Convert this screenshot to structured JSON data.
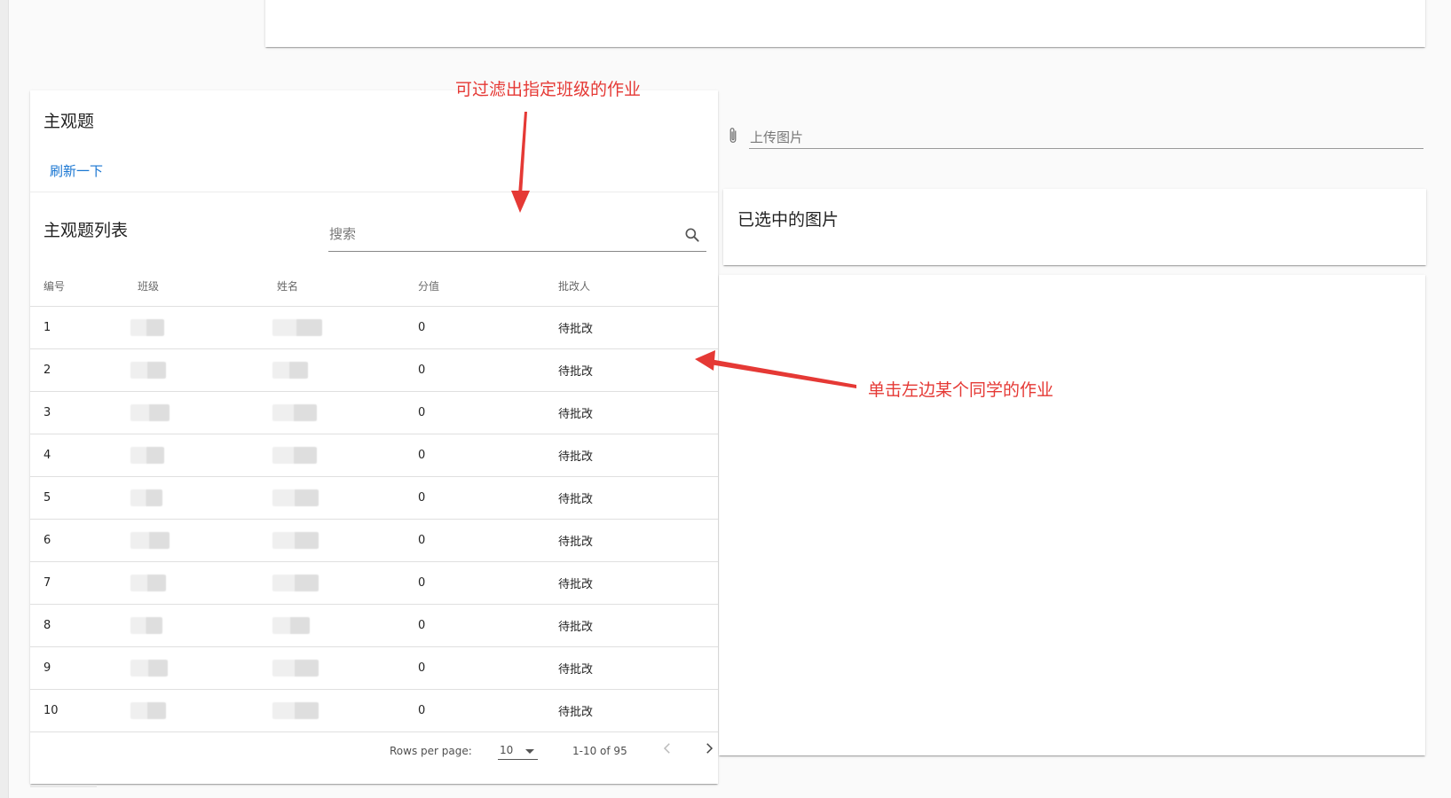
{
  "header": {
    "title": "主观题",
    "refresh_label": "刷新一下"
  },
  "list": {
    "title": "主观题列表",
    "search_placeholder": "搜索",
    "columns": [
      "编号",
      "班级",
      "姓名",
      "分值",
      "批改人"
    ],
    "rows": [
      {
        "id": "1",
        "score": "0",
        "grader": "待批改"
      },
      {
        "id": "2",
        "score": "0",
        "grader": "待批改"
      },
      {
        "id": "3",
        "score": "0",
        "grader": "待批改"
      },
      {
        "id": "4",
        "score": "0",
        "grader": "待批改"
      },
      {
        "id": "5",
        "score": "0",
        "grader": "待批改"
      },
      {
        "id": "6",
        "score": "0",
        "grader": "待批改"
      },
      {
        "id": "7",
        "score": "0",
        "grader": "待批改"
      },
      {
        "id": "8",
        "score": "0",
        "grader": "待批改"
      },
      {
        "id": "9",
        "score": "0",
        "grader": "待批改"
      },
      {
        "id": "10",
        "score": "0",
        "grader": "待批改"
      }
    ]
  },
  "pagination": {
    "rows_per_page_label": "Rows per page:",
    "rows_per_page": "10",
    "range": "1-10 of 95"
  },
  "upload": {
    "label": "上传图片"
  },
  "selected": {
    "title": "已选中的图片"
  },
  "annotations": {
    "filter_note": "可过滤出指定班级的作业",
    "click_note": "单击左边某个同学的作业"
  },
  "colors": {
    "annotation": "#e53935",
    "accent": "#1976d2"
  },
  "icons": [
    "search-icon",
    "paperclip-icon",
    "chevron-left-icon",
    "chevron-right-icon",
    "caret-down-icon"
  ]
}
